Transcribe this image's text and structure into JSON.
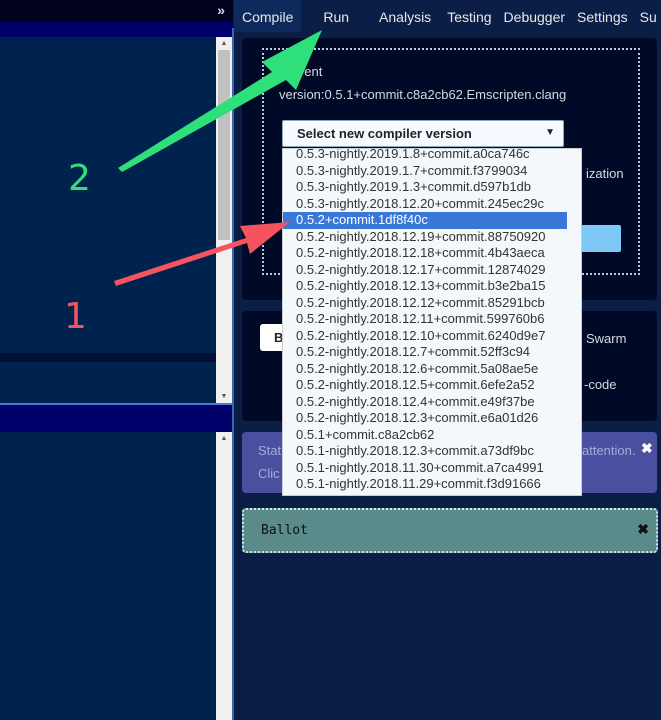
{
  "left_panel": {
    "collapse_icon": "double-chevron-right"
  },
  "tabs": [
    "Compile",
    "Run",
    "Analysis",
    "Testing",
    "Debugger",
    "Settings",
    "Su"
  ],
  "compiler": {
    "current_label": "Current",
    "current_version": "version:0.5.1+commit.c8a2cb62.Emscripten.clang",
    "select_label": "Select new compiler version",
    "optimization_fragment": "ization",
    "options": [
      "0.5.3-nightly.2019.1.8+commit.a0ca746c",
      "0.5.3-nightly.2019.1.7+commit.f3799034",
      "0.5.3-nightly.2019.1.3+commit.d597b1db",
      "0.5.3-nightly.2018.12.20+commit.245ec29c",
      "0.5.2+commit.1df8f40c",
      "0.5.2-nightly.2018.12.19+commit.88750920",
      "0.5.2-nightly.2018.12.18+commit.4b43aeca",
      "0.5.2-nightly.2018.12.17+commit.12874029",
      "0.5.2-nightly.2018.12.13+commit.b3e2ba15",
      "0.5.2-nightly.2018.12.12+commit.85291bcb",
      "0.5.2-nightly.2018.12.11+commit.599760b6",
      "0.5.2-nightly.2018.12.10+commit.6240d9e7",
      "0.5.2-nightly.2018.12.7+commit.52ff3c94",
      "0.5.2-nightly.2018.12.6+commit.5a08ae5e",
      "0.5.2-nightly.2018.12.5+commit.6efe2a52",
      "0.5.2-nightly.2018.12.4+commit.e49f37be",
      "0.5.2-nightly.2018.12.3+commit.e6a01d26",
      "0.5.1+commit.c8a2cb62",
      "0.5.1-nightly.2018.12.3+commit.a73df9bc",
      "0.5.1-nightly.2018.11.30+commit.a7ca4991",
      "0.5.1-nightly.2018.11.29+commit.f3d91666"
    ],
    "highlighted_index": 4
  },
  "details": {
    "button_fragment": "B",
    "swarm_fragment": "Swarm",
    "bytecode_fragment": "-code"
  },
  "status": {
    "line1_start": "Stat",
    "line1_end": "attention.",
    "line2_start": "Clic"
  },
  "contract": {
    "name": "Ballot"
  },
  "annotations": {
    "label1": "1",
    "label2": "2",
    "color1": "#f5535d",
    "color2": "#2fe07a"
  }
}
